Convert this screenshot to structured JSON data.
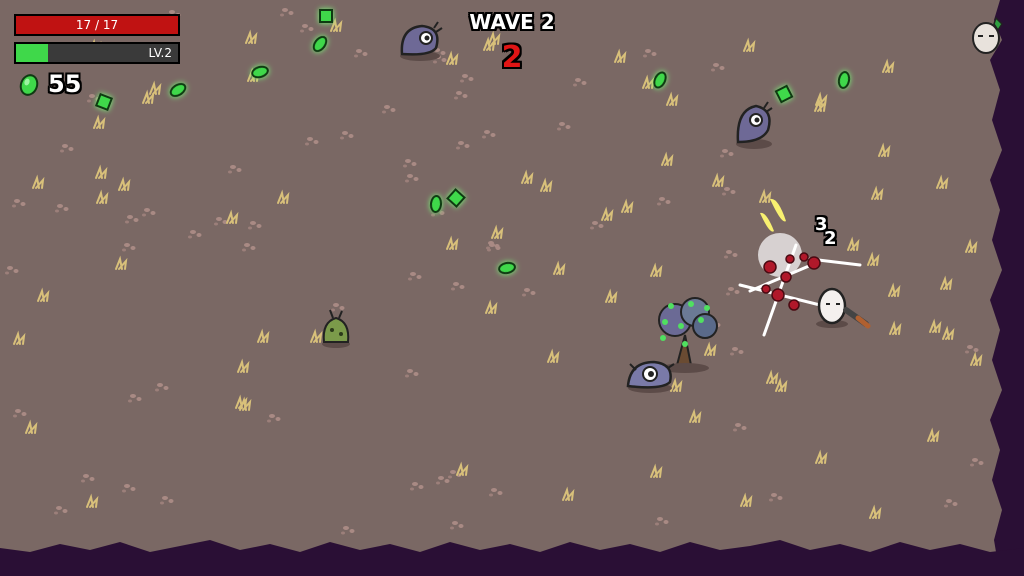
{
  "hud": {
    "hp": {
      "current": 17,
      "max": 17,
      "label": "17 / 17",
      "color": "#c01212"
    },
    "xp": {
      "label": "LV.2",
      "fraction": 0.2,
      "color": "#3fd84a"
    },
    "materials": {
      "count": "55",
      "icon": "green-material-icon"
    }
  },
  "wave": {
    "title": "WAVE 2",
    "timer": "2",
    "timer_color": "#e01515"
  },
  "combat": {
    "damage_numbers": [
      "3",
      "2"
    ]
  },
  "pickups": {
    "icon": "green-material-icon",
    "color": "#3fd84a"
  },
  "icons": {
    "player": "white-egg-potato-icon",
    "enemy": "purple-slug-alien-icon",
    "tree": "material-tree-icon",
    "corner": "egg-character-icon"
  },
  "colors": {
    "ground": "#7a6864",
    "border": "#2a0f35",
    "enemy": "#6e6996"
  }
}
